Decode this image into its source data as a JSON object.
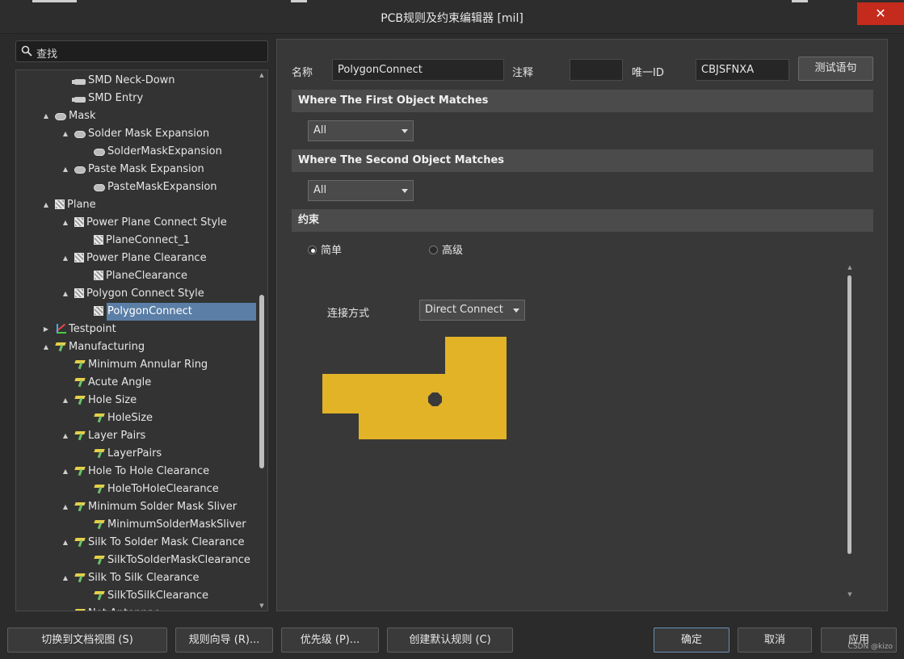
{
  "window": {
    "title": "PCB规则及约束编辑器 [mil]",
    "close_glyph": "✕"
  },
  "search": {
    "placeholder": "查找"
  },
  "tree": [
    {
      "label": "SMD Neck-Down",
      "icon": "smd-icon",
      "depth": 2,
      "arrow": ""
    },
    {
      "label": "SMD Entry",
      "icon": "smd-icon",
      "depth": 2,
      "arrow": ""
    },
    {
      "label": "Mask",
      "icon": "mask-icon",
      "depth": 1,
      "arrow": "▲"
    },
    {
      "label": "Solder Mask Expansion",
      "icon": "mask-icon",
      "depth": 2,
      "arrow": "▲"
    },
    {
      "label": "SolderMaskExpansion",
      "icon": "mask-icon",
      "depth": 3,
      "arrow": ""
    },
    {
      "label": "Paste Mask Expansion",
      "icon": "mask-icon",
      "depth": 2,
      "arrow": "▲"
    },
    {
      "label": "PasteMaskExpansion",
      "icon": "mask-icon",
      "depth": 3,
      "arrow": ""
    },
    {
      "label": "Plane",
      "icon": "plane-icon",
      "depth": 1,
      "arrow": "▲"
    },
    {
      "label": "Power Plane Connect Style",
      "icon": "plane-icon",
      "depth": 2,
      "arrow": "▲"
    },
    {
      "label": "PlaneConnect_1",
      "icon": "plane-icon",
      "depth": 3,
      "arrow": ""
    },
    {
      "label": "Power Plane Clearance",
      "icon": "plane-icon",
      "depth": 2,
      "arrow": "▲"
    },
    {
      "label": "PlaneClearance",
      "icon": "plane-icon",
      "depth": 3,
      "arrow": ""
    },
    {
      "label": "Polygon Connect Style",
      "icon": "plane-icon",
      "depth": 2,
      "arrow": "▲"
    },
    {
      "label": "PolygonConnect",
      "icon": "plane-icon",
      "depth": 3,
      "arrow": "",
      "selected": true
    },
    {
      "label": "Testpoint",
      "icon": "testpoint-icon",
      "depth": 1,
      "arrow": "▶"
    },
    {
      "label": "Manufacturing",
      "icon": "manufacturing-icon",
      "depth": 1,
      "arrow": "▲"
    },
    {
      "label": "Minimum Annular Ring",
      "icon": "manufacturing-icon",
      "depth": 2,
      "arrow": ""
    },
    {
      "label": "Acute Angle",
      "icon": "manufacturing-icon",
      "depth": 2,
      "arrow": ""
    },
    {
      "label": "Hole Size",
      "icon": "manufacturing-icon",
      "depth": 2,
      "arrow": "▲"
    },
    {
      "label": "HoleSize",
      "icon": "manufacturing-icon",
      "depth": 3,
      "arrow": ""
    },
    {
      "label": "Layer Pairs",
      "icon": "manufacturing-icon",
      "depth": 2,
      "arrow": "▲"
    },
    {
      "label": "LayerPairs",
      "icon": "manufacturing-icon",
      "depth": 3,
      "arrow": ""
    },
    {
      "label": "Hole To Hole Clearance",
      "icon": "manufacturing-icon",
      "depth": 2,
      "arrow": "▲"
    },
    {
      "label": "HoleToHoleClearance",
      "icon": "manufacturing-icon",
      "depth": 3,
      "arrow": ""
    },
    {
      "label": "Minimum Solder Mask Sliver",
      "icon": "manufacturing-icon",
      "depth": 2,
      "arrow": "▲"
    },
    {
      "label": "MinimumSolderMaskSliver",
      "icon": "manufacturing-icon",
      "depth": 3,
      "arrow": ""
    },
    {
      "label": "Silk To Solder Mask Clearance",
      "icon": "manufacturing-icon",
      "depth": 2,
      "arrow": "▲"
    },
    {
      "label": "SilkToSolderMaskClearance",
      "icon": "manufacturing-icon",
      "depth": 3,
      "arrow": ""
    },
    {
      "label": "Silk To Silk Clearance",
      "icon": "manufacturing-icon",
      "depth": 2,
      "arrow": "▲"
    },
    {
      "label": "SilkToSilkClearance",
      "icon": "manufacturing-icon",
      "depth": 3,
      "arrow": ""
    },
    {
      "label": "Net Antennae",
      "icon": "manufacturing-icon",
      "depth": 2,
      "arrow": "▲"
    }
  ],
  "rule": {
    "name_label": "名称",
    "name_value": "PolygonConnect",
    "comment_label": "注释",
    "comment_value": "",
    "uid_label": "唯一ID",
    "uid_value": "CBJSFNXA",
    "test_button": "测试语句"
  },
  "first_match": {
    "heading": "Where The First Object Matches",
    "value": "All"
  },
  "second_match": {
    "heading": "Where The Second Object Matches",
    "value": "All"
  },
  "constraints": {
    "heading": "约束",
    "mode_simple": "简单",
    "mode_advanced": "高级",
    "selected_mode": "simple",
    "connect_label": "连接方式",
    "connect_value": "Direct Connect"
  },
  "colors": {
    "copper": "#e2b227",
    "selected": "#5a7ea6",
    "close": "#c42b1c"
  },
  "footer": {
    "doc_view": "切换到文档视图 (S)",
    "rule_wizard": "规则向导 (R)...",
    "priority": "优先级 (P)...",
    "create_default": "创建默认规则 (C)",
    "ok": "确定",
    "cancel": "取消",
    "apply": "应用"
  },
  "watermark": "CSDN @kizo"
}
